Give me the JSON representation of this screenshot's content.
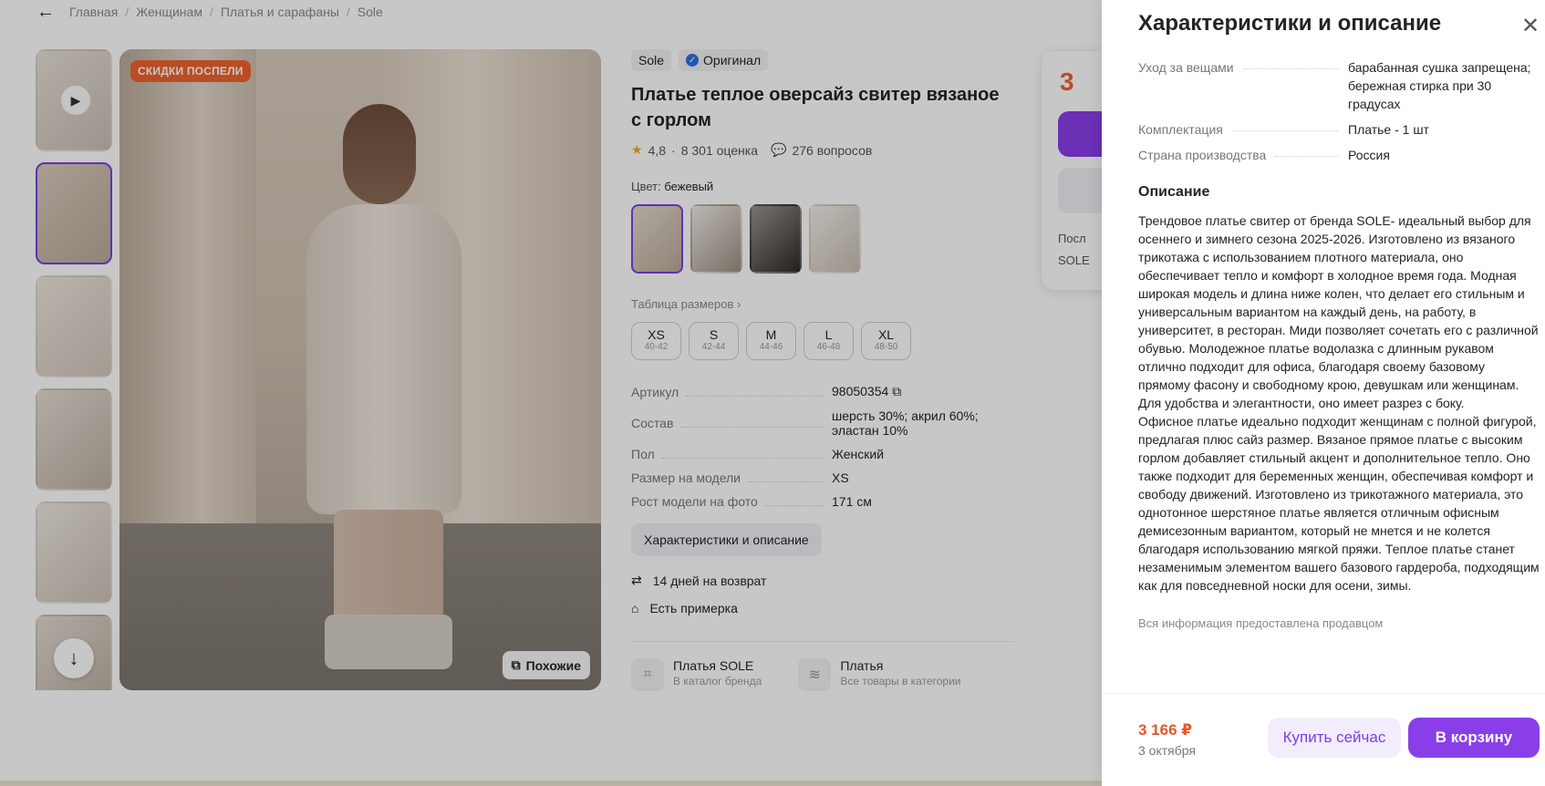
{
  "breadcrumb": [
    "Главная",
    "Женщинам",
    "Платья и сарафаны",
    "Sole"
  ],
  "gallery": {
    "sale_badge": "СКИДКИ ПОСПЕЛИ",
    "similar_label": "Похожие"
  },
  "product": {
    "brand": "Sole",
    "original_label": "Оригинал",
    "title": "Платье теплое оверсайз свитер вязаное с горлом",
    "rating": "4,8",
    "reviews": "8 301 оценка",
    "questions": "276 вопросов",
    "color_label": "Цвет:",
    "color_value": "бежевый",
    "size_table_label": "Таблица размеров",
    "sizes": [
      {
        "size": "XS",
        "range": "40-42"
      },
      {
        "size": "S",
        "range": "42-44"
      },
      {
        "size": "M",
        "range": "44-46"
      },
      {
        "size": "L",
        "range": "46-48"
      },
      {
        "size": "XL",
        "range": "48-50"
      }
    ],
    "specs": [
      {
        "key": "Артикул",
        "value": "98050354"
      },
      {
        "key": "Состав",
        "value": "шерсть 30%; акрил 60%; эластан 10%"
      },
      {
        "key": "Пол",
        "value": "Женский"
      },
      {
        "key": "Размер на модели",
        "value": "XS"
      },
      {
        "key": "Рост модели на фото",
        "value": "171 см"
      }
    ],
    "char_button": "Характеристики и описание",
    "perks": [
      "14 дней на возврат",
      "Есть примерка"
    ],
    "links": [
      {
        "title": "Платья SOLE",
        "sub": "В каталог бренда"
      },
      {
        "title": "Платья",
        "sub": "Все товары в категории"
      }
    ]
  },
  "buybox": {
    "price_partial": "3",
    "line1": "Посл",
    "line2": "SOLE"
  },
  "drawer": {
    "title": "Характеристики и описание",
    "specs": [
      {
        "key": "Уход за вещами",
        "value": "барабанная сушка запрещена; бережная стирка при 30 градусах"
      },
      {
        "key": "Комплектация",
        "value": "Платье - 1 шт"
      },
      {
        "key": "Страна производства",
        "value": "Россия"
      }
    ],
    "description_title": "Описание",
    "description": "Трендовое платье свитер от бренда SOLE- идеальный выбор для осеннего и зимнего сезона 2025-2026. Изготовлено из вязаного трикотажа с использованием плотного материала, оно обеспечивает тепло и комфорт в холодное время года. Модная широкая модель и длина ниже колен, что делает его стильным и универсальным вариантом на каждый день, на работу, в университет, в ресторан. Миди позволяет сочетать его с различной обувью. Молодежное платье водолазка с длинным рукавом отлично подходит для офиса, благодаря своему базовому прямому фасону и свободному крою, девушкам или женщинам. Для удобства и элегантности, оно имеет разрез с боку.\nОфисное платье идеально подходит женщинам с полной фигурой, предлагая плюс сайз размер. Вязаное прямое платье с высоким горлом добавляет стильный акцент и дополнительное тепло. Оно также подходит для беременных женщин, обеспечивая комфорт и свободу движений. Изготовлено из трикотажного материала, это однотонное шерстяное платье является отличным офисным демисезонным вариантом, который не мнется и не колется благодаря использованию мягкой пряжи. Теплое платье станет незаменимым элементом вашего базового гардероба, подходящим как для повседневной носки для осени, зимы.",
    "seller_note": "Вся информация предоставлена продавцом",
    "price": "3 166 ₽",
    "delivery_date": "3 октября",
    "buy_now": "Купить сейчас",
    "add_to_cart": "В корзину"
  }
}
